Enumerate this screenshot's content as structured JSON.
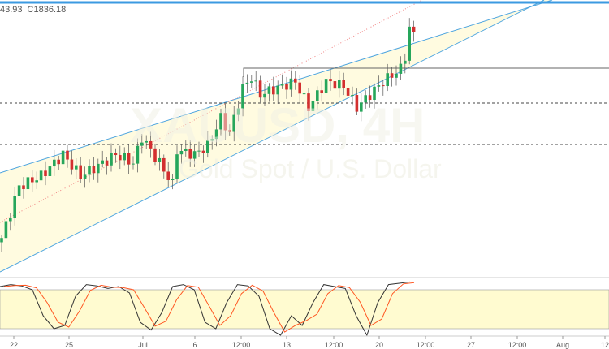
{
  "header": {
    "open_partial": "43.93",
    "close_label": "C1836.18"
  },
  "watermark": {
    "symbol": "XAUUSD, 4H",
    "name": "Gold Spot / U.S. Dollar"
  },
  "colors": {
    "up": "#26a65b",
    "down": "#d32f2f",
    "channel": "#4aa3df",
    "fill": "#fffbe0",
    "median": "#f08080",
    "stoch_k": "#333333",
    "stoch_d": "#ff5722"
  },
  "chart_data": {
    "type": "candlestick",
    "ylim": [
      1725,
      1845
    ],
    "levels": [
      1818,
      1800,
      1781
    ],
    "price_keypoints": [
      [
        0,
        1737
      ],
      [
        4,
        1761
      ],
      [
        9,
        1766
      ],
      [
        14,
        1776
      ],
      [
        18,
        1766
      ],
      [
        23,
        1772
      ],
      [
        26,
        1776
      ],
      [
        30,
        1772
      ],
      [
        32,
        1784
      ],
      [
        36,
        1772
      ],
      [
        39,
        1762
      ],
      [
        40,
        1778
      ],
      [
        44,
        1776
      ],
      [
        47,
        1780
      ],
      [
        50,
        1793
      ],
      [
        52,
        1786
      ],
      [
        55,
        1807
      ],
      [
        57,
        1812
      ],
      [
        59,
        1804
      ],
      [
        64,
        1808
      ],
      [
        67,
        1810
      ],
      [
        70,
        1798
      ],
      [
        74,
        1810
      ],
      [
        78,
        1808
      ],
      [
        81,
        1798
      ],
      [
        84,
        1804
      ],
      [
        87,
        1810
      ],
      [
        91,
        1816
      ],
      [
        92,
        1822
      ],
      [
        93,
        1835
      ],
      [
        94,
        1833
      ]
    ],
    "xticks": [
      "22",
      "25",
      "Jul",
      "6",
      "12:00",
      "13",
      "12:00",
      "20",
      "12:00",
      "27",
      "12:00",
      "Aug",
      "12"
    ],
    "stoch_k": [
      85,
      88,
      86,
      80,
      40,
      20,
      25,
      70,
      88,
      86,
      82,
      85,
      75,
      30,
      18,
      45,
      85,
      88,
      80,
      30,
      20,
      60,
      88,
      86,
      70,
      20,
      10,
      40,
      25,
      60,
      88,
      85,
      82,
      40,
      10,
      60,
      88,
      90,
      92
    ],
    "stoch_levels": [
      80,
      20
    ]
  }
}
